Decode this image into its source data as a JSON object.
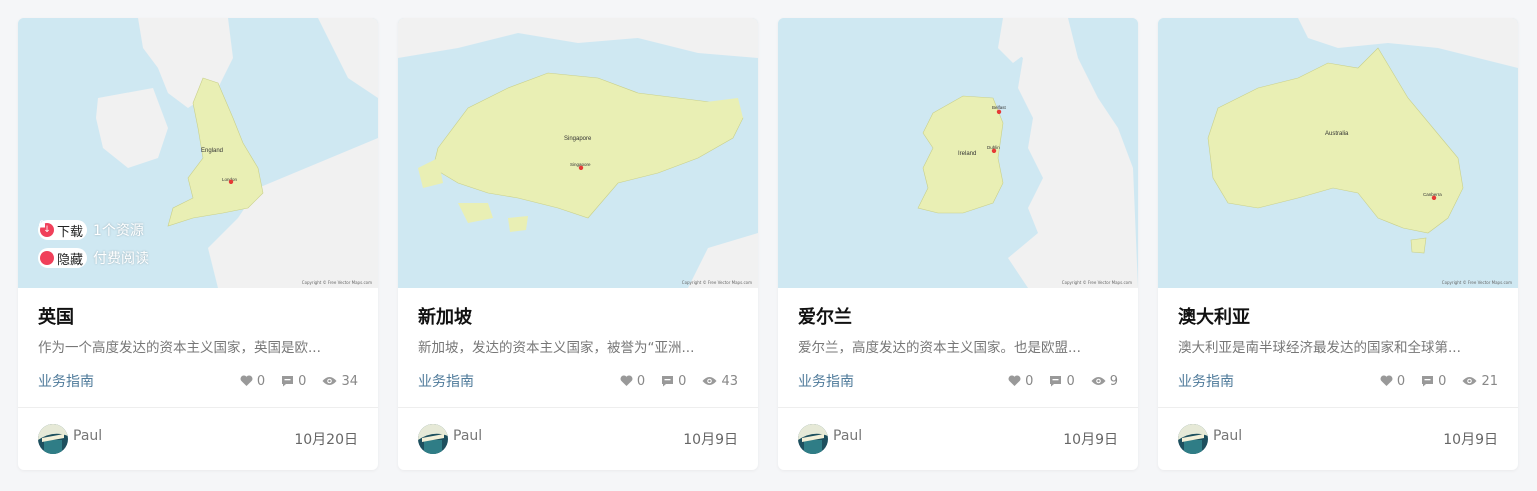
{
  "cards": [
    {
      "map_labels": [
        "England",
        "London"
      ],
      "badges": [
        {
          "label": "下载",
          "note": "1个资源",
          "icon": "download-icon"
        },
        {
          "label": "隐藏",
          "note": "付费阅读",
          "icon": "lock-icon"
        }
      ],
      "title": "英国",
      "excerpt": "作为一个高度发达的资本主义国家，英国是欧...",
      "category": "业务指南",
      "likes": "0",
      "comments": "0",
      "views": "34",
      "author": "Paul",
      "date": "10月20日"
    },
    {
      "map_labels": [
        "Singapore",
        "Singapore"
      ],
      "title": "新加坡",
      "excerpt": "新加坡，发达的资本主义国家，被誉为“亚洲...",
      "category": "业务指南",
      "likes": "0",
      "comments": "0",
      "views": "43",
      "author": "Paul",
      "date": "10月9日"
    },
    {
      "map_labels": [
        "Ireland",
        "Belfast",
        "Dublin"
      ],
      "title": "爱尔兰",
      "excerpt": "爱尔兰，高度发达的资本主义国家。也是欧盟...",
      "category": "业务指南",
      "likes": "0",
      "comments": "0",
      "views": "9",
      "author": "Paul",
      "date": "10月9日"
    },
    {
      "map_labels": [
        "Australia",
        "Canberra"
      ],
      "title": "澳大利亚",
      "excerpt": "澳大利亚是南半球经济最发达的国家和全球第...",
      "category": "业务指南",
      "likes": "0",
      "comments": "0",
      "views": "21",
      "author": "Paul",
      "date": "10月9日"
    }
  ],
  "map_copyright": "Copyright © Free Vector Maps.com",
  "colors": {
    "sea": "#cfe8f2",
    "land": "#f1f1f1",
    "highlight": "#e9efb4",
    "badge_red": "#f0405a",
    "category": "#4e7a9a"
  }
}
